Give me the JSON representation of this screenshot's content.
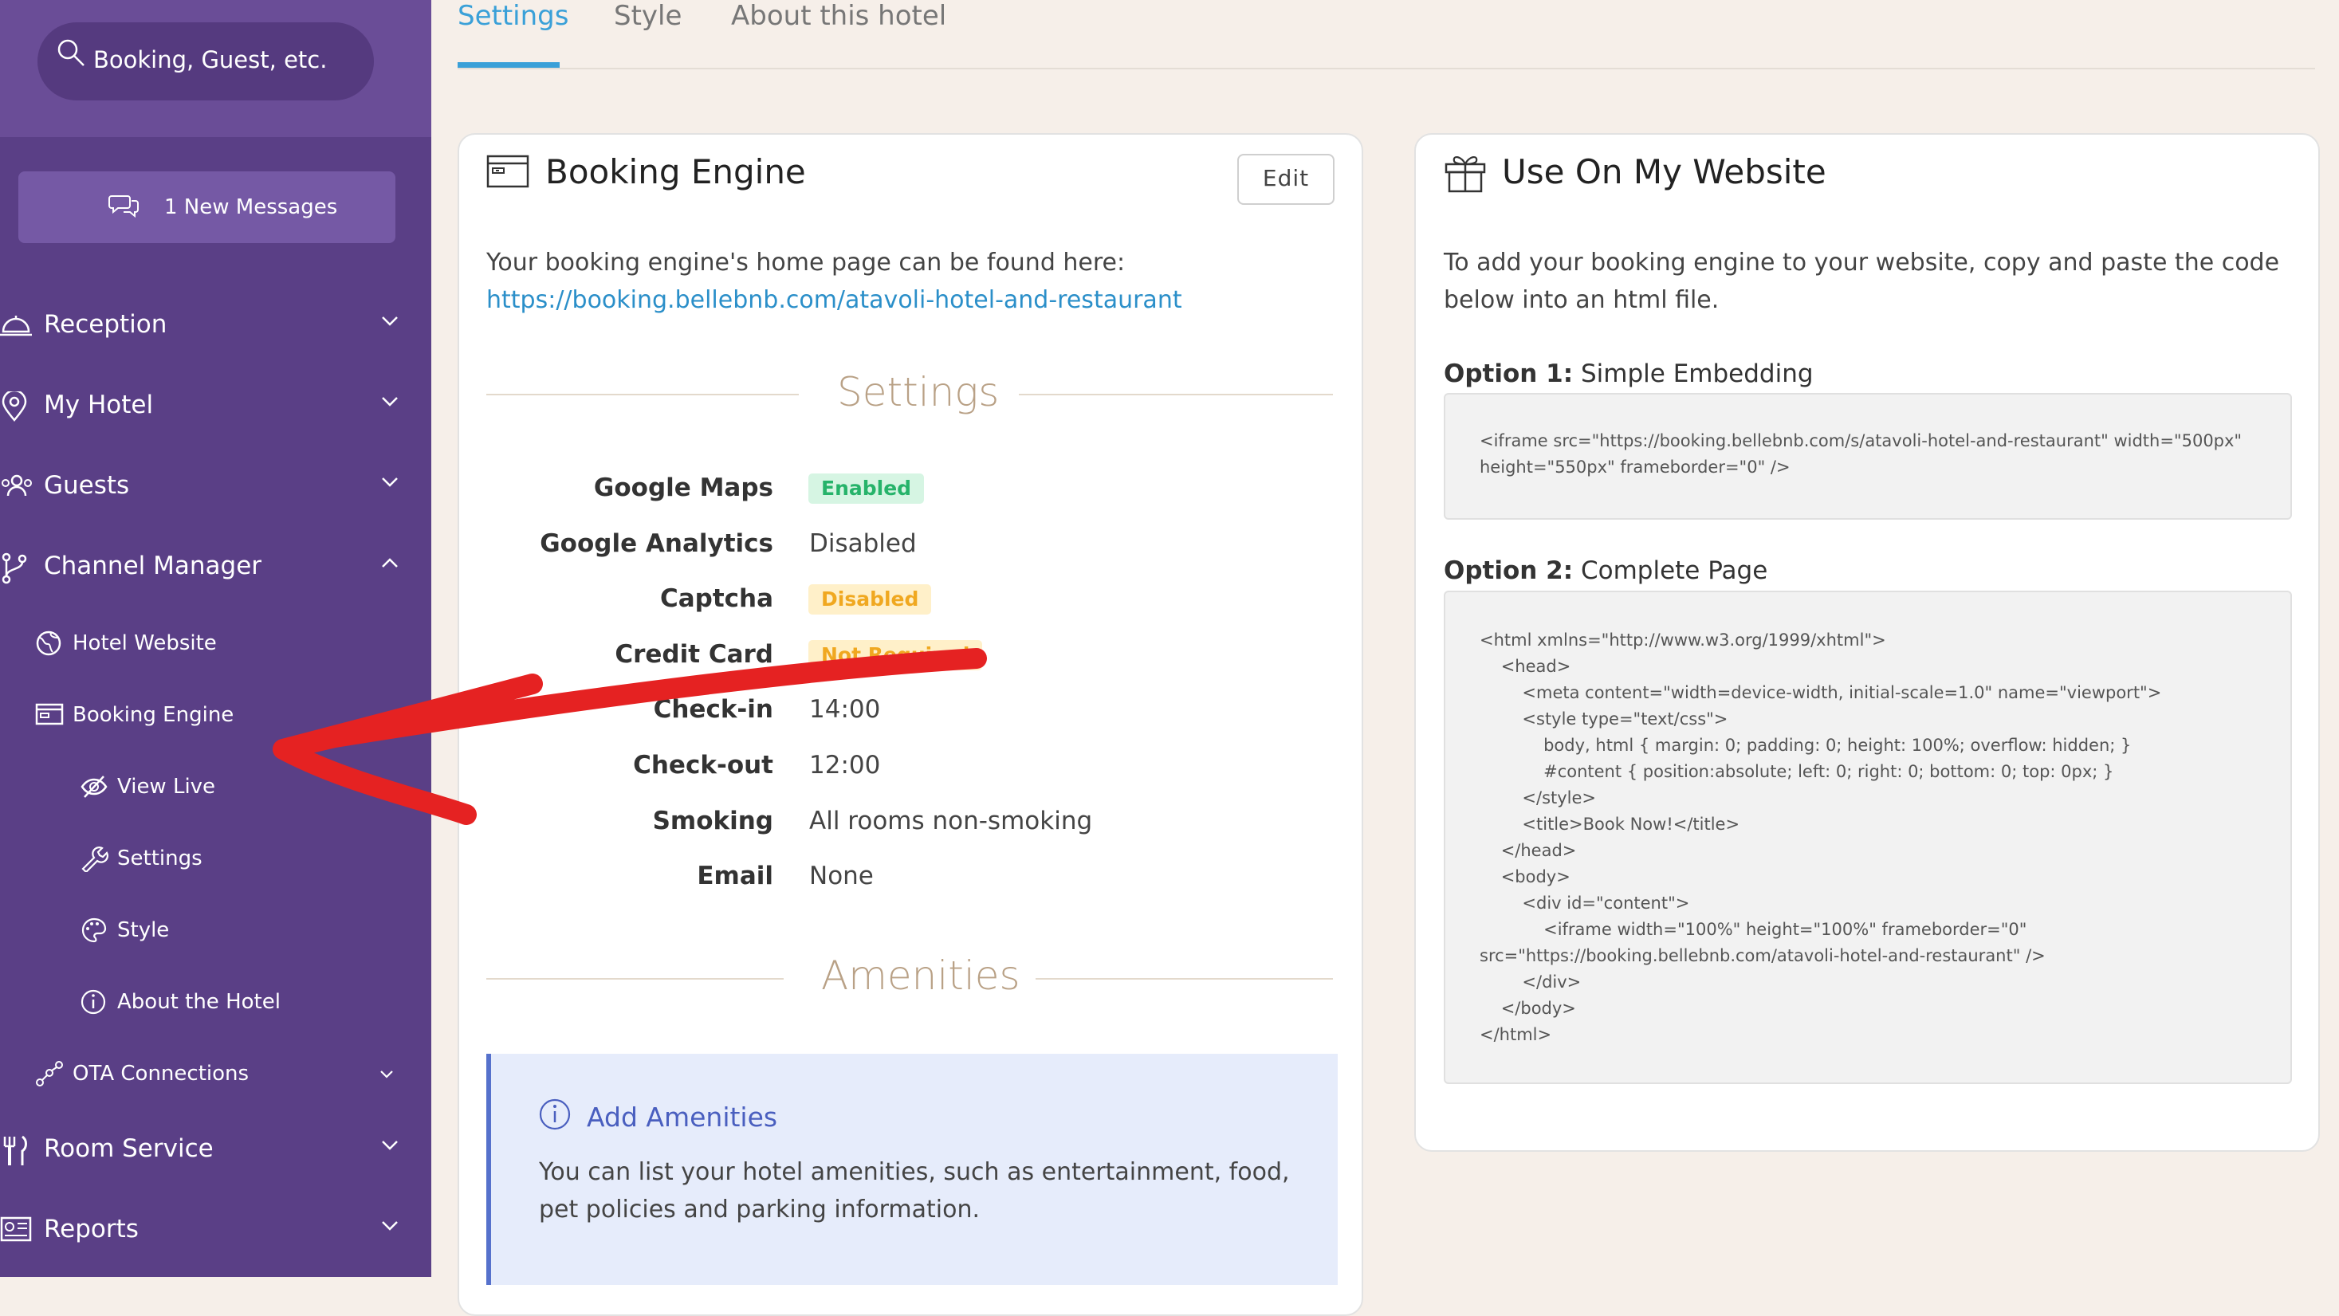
{
  "sidebar": {
    "search_placeholder": "Booking, Guest, etc.",
    "messages_label": "1 New Messages",
    "nav": {
      "reception": "Reception",
      "my_hotel": "My Hotel",
      "guests": "Guests",
      "channel_manager": "Channel Manager",
      "hotel_website": "Hotel Website",
      "booking_engine": "Booking Engine",
      "view_live": "View Live",
      "settings": "Settings",
      "style": "Style",
      "about_hotel": "About the Hotel",
      "ota_connections": "OTA Connections",
      "room_service": "Room Service",
      "reports": "Reports"
    }
  },
  "tabs": [
    "Settings",
    "Style",
    "About this hotel"
  ],
  "booking_engine": {
    "title": "Booking Engine",
    "edit_label": "Edit",
    "intro": "Your booking engine's home page can be found here:",
    "url": "https://booking.bellebnb.com/atavoli-hotel-and-restaurant",
    "settings_heading": "Settings",
    "settings": [
      {
        "label": "Google Maps",
        "value": "Enabled"
      },
      {
        "label": "Google Analytics",
        "value": "Disabled"
      },
      {
        "label": "Captcha",
        "value": "Disabled"
      },
      {
        "label": "Credit Card",
        "value": "Not Required"
      },
      {
        "label": "Check-in",
        "value": "14:00"
      },
      {
        "label": "Check-out",
        "value": "12:00"
      },
      {
        "label": "Smoking",
        "value": "All rooms non-smoking"
      },
      {
        "label": "Email",
        "value": "None"
      }
    ],
    "amenities_heading": "Amenities",
    "amenities_alert": {
      "title": "Add Amenities",
      "body": "You can list your hotel amenities, such as entertainment, food, pet policies and parking information."
    }
  },
  "website": {
    "title": "Use On My Website",
    "intro": "To add your booking engine to your website, copy and paste the code below into an html file.",
    "option1_prefix": "Option 1:",
    "option1_name": "Simple Embedding",
    "option1_code": "<iframe src=\"https://booking.bellebnb.com/s/atavoli-hotel-and-restaurant\" width=\"500px\"\nheight=\"550px\" frameborder=\"0\" />",
    "option2_prefix": "Option 2:",
    "option2_name": "Complete Page",
    "option2_code": "<html xmlns=\"http://www.w3.org/1999/xhtml\">\n    <head>\n        <meta content=\"width=device-width, initial-scale=1.0\" name=\"viewport\">\n        <style type=\"text/css\">\n            body, html { margin: 0; padding: 0; height: 100%; overflow: hidden; }\n            #content { position:absolute; left: 0; right: 0; bottom: 0; top: 0px; }\n        </style>\n        <title>Book Now!</title>\n    </head>\n    <body>\n        <div id=\"content\">\n            <iframe width=\"100%\" height=\"100%\" frameborder=\"0\"\nsrc=\"https://booking.bellebnb.com/atavoli-hotel-and-restaurant\" />\n        </div>\n    </body>\n</html>"
  },
  "colors": {
    "sidebar": "#5a3f86",
    "accent": "#3aa0d8",
    "annotation_arrow": "#e52222"
  }
}
